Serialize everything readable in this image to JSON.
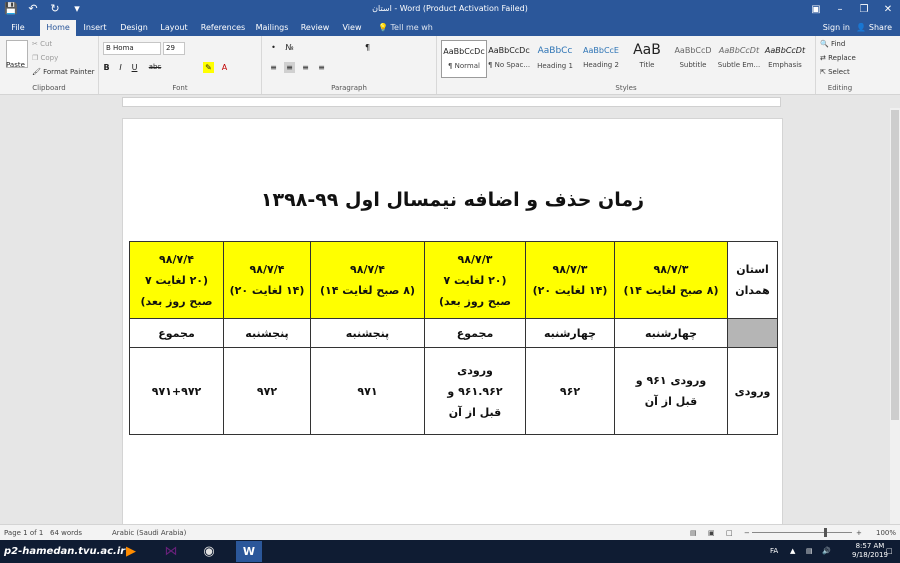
{
  "window": {
    "title": "استان - Word (Product Activation Failed)",
    "sign_in": "Sign in",
    "share": "Share",
    "tell_me": "Tell me wh"
  },
  "ribbon_tabs": [
    "File",
    "Home",
    "Insert",
    "Design",
    "Layout",
    "References",
    "Mailings",
    "Review",
    "View"
  ],
  "active_tab": "Home",
  "clipboard": {
    "paste": "Paste",
    "cut": "Cut",
    "copy": "Copy",
    "format_painter": "Format Painter",
    "label": "Clipboard"
  },
  "font": {
    "name": "B Homa",
    "size": "29",
    "label": "Font",
    "bold": "B",
    "italic": "I",
    "underline": "U",
    "strike": "abc"
  },
  "paragraph": {
    "label": "Paragraph"
  },
  "styles": {
    "label": "Styles",
    "items": [
      {
        "sample": "AaBbCcDc",
        "name": "¶ Normal"
      },
      {
        "sample": "AaBbCcDc",
        "name": "¶ No Spac..."
      },
      {
        "sample": "AaBbCc",
        "name": "Heading 1"
      },
      {
        "sample": "AaBbCcE",
        "name": "Heading 2"
      },
      {
        "sample": "AaB",
        "name": "Title"
      },
      {
        "sample": "AaBbCcD",
        "name": "Subtitle"
      },
      {
        "sample": "AaBbCcDt",
        "name": "Subtle Em..."
      },
      {
        "sample": "AaBbCcDt",
        "name": "Emphasis"
      }
    ]
  },
  "editing": {
    "find": "Find",
    "replace": "Replace",
    "select": "Select",
    "label": "Editing"
  },
  "document": {
    "title": "زمان حذف و اضافه نیمسال اول ۹۹-۱۳۹۸",
    "table": {
      "corner": [
        "استان",
        "همدان"
      ],
      "headers": [
        [
          "۹۸/۷/۳",
          "(۸ صبح لغایت ۱۴)"
        ],
        [
          "۹۸/۷/۳",
          "(۱۴ لغایت ۲۰)"
        ],
        [
          "۹۸/۷/۳",
          "(۲۰ لغایت ۷",
          "صبح روز بعد)"
        ],
        [
          "۹۸/۷/۴",
          "(۸ صبح لغایت ۱۴)"
        ],
        [
          "۹۸/۷/۴",
          "(۱۴ لغایت ۲۰)"
        ],
        [
          "۹۸/۷/۴",
          "(۲۰ لغایت ۷",
          "صبح روز بعد)"
        ]
      ],
      "days": [
        "چهارشنبه",
        "چهارشنبه",
        "مجموع",
        "پنجشنبه",
        "پنجشنبه",
        "مجموع"
      ],
      "row_label": "ورودی",
      "row_values": [
        [
          "ورودی ۹۶۱ و",
          "قبل از آن"
        ],
        [
          "۹۶۲"
        ],
        [
          "ورودی",
          "۹۶۱.۹۶۲ و",
          "قبل از آن"
        ],
        [
          "۹۷۱"
        ],
        [
          "۹۷۲"
        ],
        [
          "۹۷۱+۹۷۲"
        ]
      ]
    }
  },
  "status": {
    "page": "Page 1 of 1",
    "words": "64 words",
    "language": "Arabic (Saudi Arabia)",
    "zoom": "100%"
  },
  "taskbar": {
    "watermark": "p2-hamedan.tvu.ac.ir",
    "lang": "FA",
    "time": "8:57 AM",
    "date": "9/18/2019"
  }
}
